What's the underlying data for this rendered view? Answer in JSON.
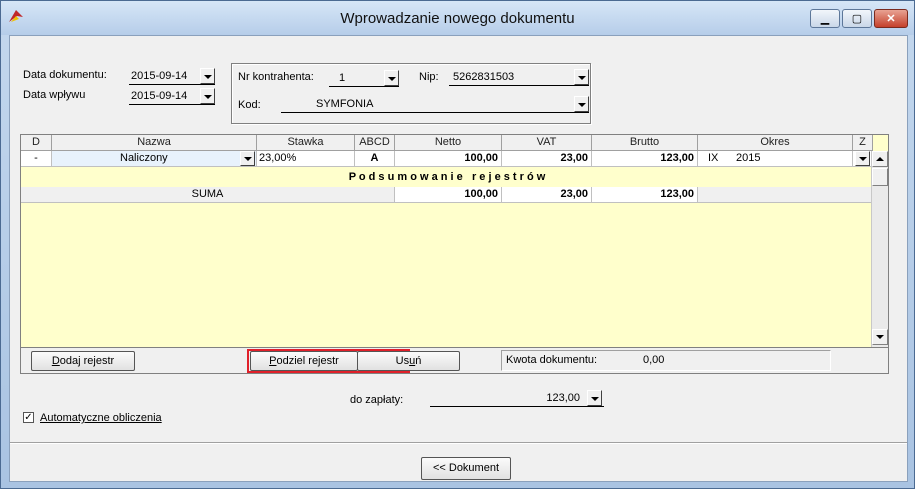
{
  "window": {
    "title": "Wprowadzanie nowego dokumentu",
    "min_glyph": "▁",
    "max_glyph": "▢",
    "close_glyph": "✕"
  },
  "dates": {
    "doc_label": "Data dokumentu:",
    "doc_value": "2015-09-14",
    "received_label": "Data wpływu",
    "received_value": "2015-09-14"
  },
  "contractor": {
    "nr_label": "Nr kontrahenta:",
    "nr_value": "1",
    "nip_label": "Nip:",
    "nip_value": "5262831503",
    "code_label": "Kod:",
    "code_value": "SYMFONIA"
  },
  "grid": {
    "columns": [
      "D",
      "Nazwa",
      "Stawka",
      "ABCD",
      "Netto",
      "VAT",
      "Brutto",
      "Okres",
      "Z"
    ],
    "row": {
      "d": "-",
      "nazwa": "Naliczony",
      "stawka": "23,00%",
      "abcd": "A",
      "netto": "100,00",
      "vat": "23,00",
      "brutto": "123,00",
      "okres_month": "IX",
      "okres_year": "2015"
    },
    "summary_title": "P o d s u m o w a n i e   r e j e s t r ó w",
    "sum": {
      "label": "SUMA",
      "netto": "100,00",
      "vat": "23,00",
      "brutto": "123,00"
    }
  },
  "buttons": {
    "add": {
      "underlined": "D",
      "rest": "odaj rejestr"
    },
    "split": {
      "underlined": "P",
      "rest": "odziel rejestr"
    },
    "remove": {
      "prefix": "Us",
      "underlined": "u",
      "rest": "ń"
    },
    "document": "<< Dokument"
  },
  "doc_amount": {
    "label": "Kwota dokumentu:",
    "value": "0,00"
  },
  "payment": {
    "label": "do zapłaty:",
    "value": "123,00"
  },
  "auto_calc": {
    "label": "Automatyczne obliczenia",
    "checked": "✓"
  },
  "colors": {
    "grid_bg": "#ffffcc",
    "highlight_border": "#e0202a",
    "selection": "#e8f2fc"
  }
}
